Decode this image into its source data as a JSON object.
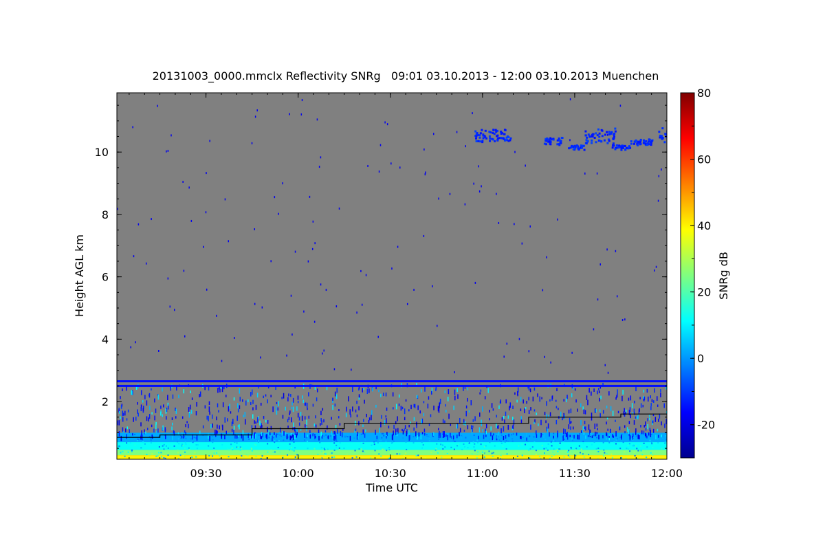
{
  "chart_data": {
    "type": "heatmap",
    "title": "20131003_0000.mmclx Reflectivity SNRg   09:01 03.10.2013 - 12:00 03.10.2013 Muenchen",
    "xlabel": "Time UTC",
    "ylabel": "Height AGL km",
    "colorbar_label": "SNRg dB",
    "x_range_hours": [
      9.0167,
      12.0
    ],
    "y_range_km": [
      0.15,
      11.9
    ],
    "x_ticks": [
      {
        "value": 9.5,
        "label": "09:30"
      },
      {
        "value": 10.0,
        "label": "10:00"
      },
      {
        "value": 10.5,
        "label": "10:30"
      },
      {
        "value": 11.0,
        "label": "11:00"
      },
      {
        "value": 11.5,
        "label": "11:30"
      },
      {
        "value": 12.0,
        "label": "12:00"
      }
    ],
    "y_ticks": [
      {
        "value": 2,
        "label": "2"
      },
      {
        "value": 4,
        "label": "4"
      },
      {
        "value": 6,
        "label": "6"
      },
      {
        "value": 8,
        "label": "8"
      },
      {
        "value": 10,
        "label": "10"
      }
    ],
    "colorbar_range": [
      -30,
      80
    ],
    "colorbar_ticks": [
      {
        "value": -20,
        "label": "-20"
      },
      {
        "value": 0,
        "label": "0"
      },
      {
        "value": 20,
        "label": "20"
      },
      {
        "value": 40,
        "label": "40"
      },
      {
        "value": 60,
        "label": "60"
      },
      {
        "value": 80,
        "label": "80"
      }
    ],
    "background_color": "#808080",
    "surface_layers": [
      {
        "y_bottom_km": 0.15,
        "y_top_km": 0.28,
        "snr_db": 40
      },
      {
        "y_bottom_km": 0.28,
        "y_top_km": 0.45,
        "snr_db": 25
      },
      {
        "y_bottom_km": 0.45,
        "y_top_km": 0.7,
        "snr_db": 12
      },
      {
        "y_bottom_km": 0.7,
        "y_top_km": 1.0,
        "snr_db": 2
      }
    ],
    "constant_bands_km": [
      {
        "y_km": 2.65,
        "snr_db": -15
      },
      {
        "y_km": 2.5,
        "snr_db": -15
      }
    ],
    "boundary_layer_height": [
      {
        "t": 9.0167,
        "h_km": 0.85
      },
      {
        "t": 9.25,
        "h_km": 0.85
      },
      {
        "t": 9.25,
        "h_km": 0.93
      },
      {
        "t": 9.75,
        "h_km": 0.93
      },
      {
        "t": 9.75,
        "h_km": 1.13
      },
      {
        "t": 10.25,
        "h_km": 1.13
      },
      {
        "t": 10.25,
        "h_km": 1.3
      },
      {
        "t": 11.25,
        "h_km": 1.3
      },
      {
        "t": 11.25,
        "h_km": 1.5
      },
      {
        "t": 11.75,
        "h_km": 1.5
      },
      {
        "t": 11.75,
        "h_km": 1.6
      },
      {
        "t": 12.0,
        "h_km": 1.6
      }
    ],
    "cirrus_patches": [
      {
        "t_start": 10.95,
        "t_end": 11.15,
        "h_bottom_km": 10.35,
        "h_top_km": 10.75,
        "snr_db": -15
      },
      {
        "t_start": 11.33,
        "t_end": 11.43,
        "h_bottom_km": 10.25,
        "h_top_km": 10.5,
        "snr_db": -15
      },
      {
        "t_start": 11.46,
        "t_end": 11.55,
        "h_bottom_km": 10.1,
        "h_top_km": 10.25,
        "snr_db": -15
      },
      {
        "t_start": 11.55,
        "t_end": 11.72,
        "h_bottom_km": 10.3,
        "h_top_km": 10.8,
        "snr_db": -15
      },
      {
        "t_start": 11.7,
        "t_end": 11.8,
        "h_bottom_km": 10.1,
        "h_top_km": 10.25,
        "snr_db": -15
      },
      {
        "t_start": 11.8,
        "t_end": 11.92,
        "h_bottom_km": 10.25,
        "h_top_km": 10.45,
        "snr_db": -15
      },
      {
        "t_start": 11.95,
        "t_end": 12.0,
        "h_bottom_km": 10.3,
        "h_top_km": 10.8,
        "snr_db": -15
      }
    ]
  }
}
